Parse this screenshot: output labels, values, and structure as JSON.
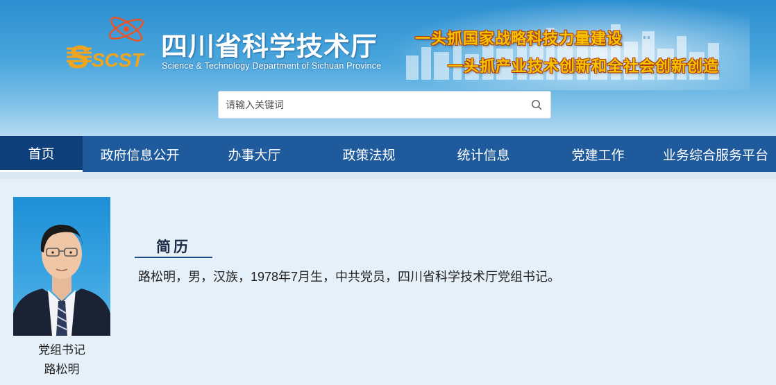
{
  "header": {
    "logo_text": "SCST",
    "title": "四川省科学技术厅",
    "subtitle": "Science & Technology Department of Sichuan Province",
    "slogan_1": "一头抓国家战略科技力量建设",
    "slogan_2": "一头抓产业技术创新和全社会创新创造"
  },
  "search": {
    "placeholder": "请输入关键词",
    "value": "",
    "icon": "search-icon"
  },
  "nav": {
    "items": [
      {
        "label": "首页",
        "active": true
      },
      {
        "label": "政府信息公开",
        "active": false
      },
      {
        "label": "办事大厅",
        "active": false
      },
      {
        "label": "政策法规",
        "active": false
      },
      {
        "label": "统计信息",
        "active": false
      },
      {
        "label": "党建工作",
        "active": false
      },
      {
        "label": "业务综合服务平台",
        "active": false
      }
    ]
  },
  "profile": {
    "role": "党组书记",
    "name": "路松明",
    "section_title": "简历",
    "bio": "路松明，男，汉族，1978年7月生，中共党员，四川省科学技术厅党组书记。"
  },
  "colors": {
    "nav_background": "#1f5a9c",
    "nav_active": "#0e3f7a",
    "page_background": "#e6f0f9",
    "slogan_fill": "#f5c400",
    "slogan_outline": "#b03a10"
  }
}
